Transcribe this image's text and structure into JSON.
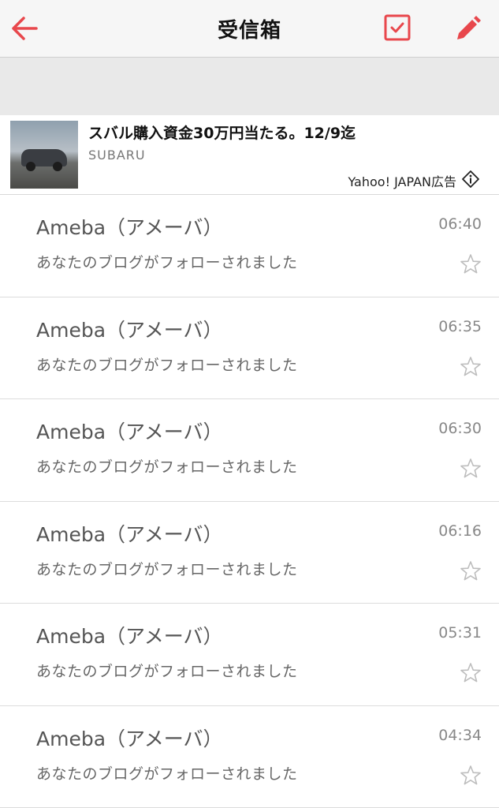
{
  "header": {
    "title": "受信箱",
    "accent_color": "#e8474c",
    "back_icon": "back-arrow-icon",
    "select_icon": "checkbox-icon",
    "compose_icon": "pencil-icon"
  },
  "ad": {
    "title": "スバル購入資金30万円当たる。12/9迄",
    "sponsor": "SUBARU",
    "label": "Yahoo! JAPAN広告",
    "info_icon": "ad-info-icon"
  },
  "messages": [
    {
      "sender": "Ameba（アメーバ）",
      "subject": "あなたのブログがフォローされました",
      "time": "06:40"
    },
    {
      "sender": "Ameba（アメーバ）",
      "subject": "あなたのブログがフォローされました",
      "time": "06:35"
    },
    {
      "sender": "Ameba（アメーバ）",
      "subject": "あなたのブログがフォローされました",
      "time": "06:30"
    },
    {
      "sender": "Ameba（アメーバ）",
      "subject": "あなたのブログがフォローされました",
      "time": "06:16"
    },
    {
      "sender": "Ameba（アメーバ）",
      "subject": "あなたのブログがフォローされました",
      "time": "05:31"
    },
    {
      "sender": "Ameba（アメーバ）",
      "subject": "あなたのブログがフォローされました",
      "time": "04:34"
    }
  ]
}
